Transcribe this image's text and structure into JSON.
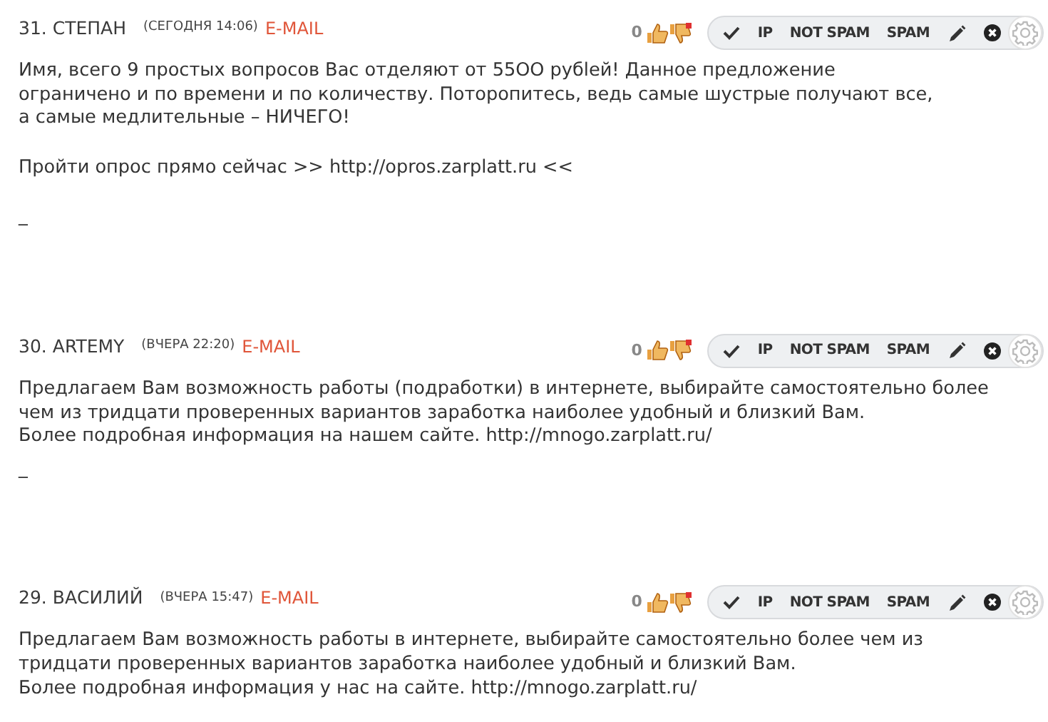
{
  "comments": [
    {
      "number": "31.",
      "author": "СТЕПАН",
      "date": "(СЕГОДНЯ 14:06)",
      "email": "E-MAIL",
      "votes": "0",
      "actions": [
        "IP",
        "NOT SPAM",
        "SPAM"
      ],
      "paragraphs": [
        {
          "kind": "paragraph",
          "lines": [
            "Имя, всего 9 простых вопросов Вас отделяют от 55OO рyбleй! Данное предложение",
            "ограничено и по времени и по количеству. Поторопитесь, ведь самые шустрые получают все,",
            "а самые медлительные – НИЧЕГО!"
          ]
        },
        {
          "kind": "paragraph",
          "lines": [
            "Пройти опрос прямо сейчас >> http://opros.zarplatt.ru <<"
          ]
        },
        {
          "kind": "paragraph",
          "lines": [
            "_"
          ]
        }
      ]
    },
    {
      "number": "30.",
      "author": "ARTEMY",
      "date": "(ВЧЕРА 22:20)",
      "email": "E-MAIL",
      "votes": "0",
      "actions": [
        "IP",
        "NOT SPAM",
        "SPAM"
      ],
      "paragraphs": [
        {
          "kind": "paragraph",
          "lines": [
            "Предлагаем Вам возможность работы (подработки) в интернете, выбирайте самостоятельно более",
            "чем из тридцати проверенных вариантов заработка наиболее удобный и близкий Вам.",
            "Более подробная информация на нашем сайте. http://mnogo.zarplatt.ru/"
          ]
        },
        {
          "kind": "trailer",
          "lines": [
            "_"
          ]
        }
      ]
    },
    {
      "number": "29.",
      "author": "ВАСИЛИЙ",
      "date": "(ВЧЕРА 15:47)",
      "email": "E-MAIL",
      "votes": "0",
      "actions": [
        "IP",
        "NOT SPAM",
        "SPAM"
      ],
      "paragraphs": [
        {
          "kind": "paragraph",
          "lines": [
            "Предлагаем Вам возможность работы в интернете, выбирайте самостоятельно более чем из",
            "тридцати проверенных вариантов заработка наиболее удобный и близкий Вам.",
            "Более подробная информация у нас на сайте. http://mnogo.zarplatt.ru/"
          ]
        }
      ]
    }
  ]
}
